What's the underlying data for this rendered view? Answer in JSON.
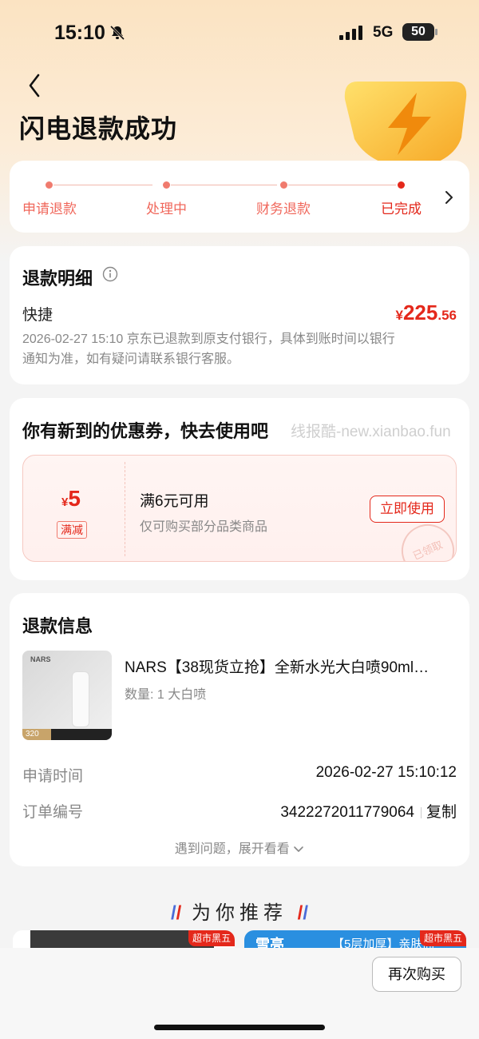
{
  "status_bar": {
    "time": "15:10",
    "network": "5G",
    "battery": "50"
  },
  "header": {
    "title": "闪电退款成功"
  },
  "progress": {
    "steps": [
      {
        "label": "申请退款"
      },
      {
        "label": "处理中"
      },
      {
        "label": "财务退款"
      },
      {
        "label": "已完成"
      }
    ]
  },
  "refund_detail": {
    "title": "退款明细",
    "method": "快捷",
    "amount_currency": "¥",
    "amount_integer": "225",
    "amount_decimal": ".56",
    "description": "2026-02-27 15:10 京东已退款到原支付银行，具体到账时间以银行通知为准，如有疑问请联系银行客服。"
  },
  "coupon_section": {
    "title": "你有新到的优惠券，快去使用吧",
    "watermark": "线报酷-new.xianbao.fun",
    "coupon": {
      "currency": "¥",
      "value": "5",
      "tag": "满减",
      "condition": "满6元可用",
      "scope": "仅可购买部分品类商品",
      "button": "立即使用",
      "stamp": "已领取"
    }
  },
  "refund_info": {
    "title": "退款信息",
    "product": {
      "image_brand": "NARS",
      "image_badge": "320",
      "name": "NARS【38现货立抢】全新水光大白喷90ml…",
      "meta": "数量: 1  大白喷"
    },
    "rows": [
      {
        "label": "申请时间",
        "value": "2026-02-27 15:10:12"
      },
      {
        "label": "订单编号",
        "value": "3422272011779064",
        "action": "复制"
      }
    ],
    "expand_text": "遇到问题，展开看看"
  },
  "recommend": {
    "title": "为你推荐",
    "cards": [
      {
        "mark": "超市黑五"
      },
      {
        "brand_text": "雪亮",
        "promo_text": "【5层加厚】亲肤面",
        "mark": "超市黑五"
      }
    ]
  },
  "bottom_bar": {
    "rebuy_label": "再次购买"
  }
}
